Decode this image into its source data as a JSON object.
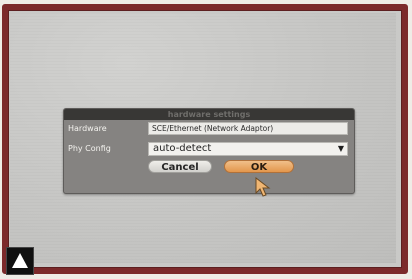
{
  "dialog": {
    "title": "hardware settings",
    "hardware_label": "Hardware",
    "hardware_value": "SCE/Ethernet (Network Adaptor)",
    "phy_label": "Phy Config",
    "phy_value": "auto-detect",
    "cancel_label": "Cancel",
    "ok_label": "OK"
  },
  "icons": {
    "dropdown": "chevron-down-icon",
    "cursor": "pointer-cursor-icon",
    "back": "triangle-up-icon"
  },
  "colors": {
    "frame_border": "#7c2a2b",
    "screen_bg": "#c8c8c6",
    "dialog_bg": "#858381",
    "title_bar": "#383735",
    "ok_button": "#e8a35e"
  }
}
